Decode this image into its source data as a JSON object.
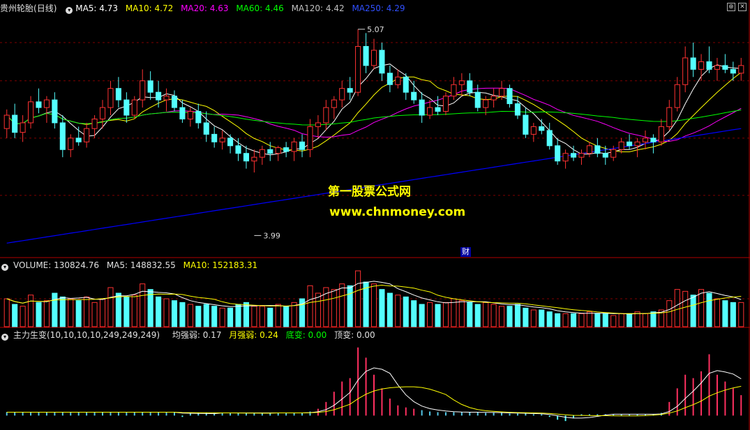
{
  "stock": {
    "name": "贵州轮胎",
    "period": "(日线)"
  },
  "price_header": {
    "ma5": "MA5: 4.73",
    "ma10": "MA10: 4.72",
    "ma20": "MA20: 4.63",
    "ma60": "MA60: 4.46",
    "ma120": "MA120: 4.42",
    "ma250": "MA250: 4.29"
  },
  "volume_header": {
    "label": "VOLUME: 130824.76",
    "ma5": "MA5: 148832.55",
    "ma10": "MA10: 152183.31"
  },
  "indicator_header": {
    "label": "主力生变(10,10,10,10,249,249,249)",
    "avg": "均强弱: 0.17",
    "month": "月强弱: 0.24",
    "bottom": "底变: 0.00",
    "top": "顶变: 0.00"
  },
  "annotations": {
    "high": "5.07",
    "low": "3.99",
    "finance_badge": "财"
  },
  "watermark": {
    "line1": "第一股票公式网",
    "line2": "www.chnmoney.com"
  },
  "colors": {
    "up": "#ff3232",
    "down": "#54ffff",
    "ma5": "#ffffff",
    "ma10": "#ffff00",
    "ma20": "#ff00ff",
    "ma60": "#00ff00",
    "ma120": "#c0c0c0",
    "ma250": "#0000ff"
  },
  "chart_data": {
    "type": "candlestick",
    "price_axis_range": [
      3.9,
      5.15
    ],
    "high_marker": 5.07,
    "low_marker": 3.99,
    "candles": [
      [
        4.55,
        4.65,
        4.5,
        4.62
      ],
      [
        4.62,
        4.68,
        4.5,
        4.53
      ],
      [
        4.53,
        4.62,
        4.48,
        4.58
      ],
      [
        4.58,
        4.72,
        4.55,
        4.69
      ],
      [
        4.69,
        4.76,
        4.63,
        4.66
      ],
      [
        4.66,
        4.72,
        4.58,
        4.7
      ],
      [
        4.7,
        4.74,
        4.55,
        4.58
      ],
      [
        4.58,
        4.62,
        4.4,
        4.44
      ],
      [
        4.44,
        4.52,
        4.4,
        4.5
      ],
      [
        4.5,
        4.56,
        4.46,
        4.48
      ],
      [
        4.48,
        4.58,
        4.45,
        4.55
      ],
      [
        4.55,
        4.62,
        4.5,
        4.6
      ],
      [
        4.6,
        4.7,
        4.55,
        4.66
      ],
      [
        4.66,
        4.8,
        4.62,
        4.76
      ],
      [
        4.76,
        4.82,
        4.66,
        4.7
      ],
      [
        4.7,
        4.74,
        4.58,
        4.62
      ],
      [
        4.62,
        4.72,
        4.6,
        4.7
      ],
      [
        4.7,
        4.86,
        4.66,
        4.8
      ],
      [
        4.8,
        4.85,
        4.7,
        4.74
      ],
      [
        4.74,
        4.8,
        4.66,
        4.7
      ],
      [
        4.7,
        4.76,
        4.64,
        4.72
      ],
      [
        4.72,
        4.75,
        4.64,
        4.66
      ],
      [
        4.66,
        4.7,
        4.58,
        4.6
      ],
      [
        4.6,
        4.66,
        4.56,
        4.64
      ],
      [
        4.64,
        4.68,
        4.55,
        4.58
      ],
      [
        4.58,
        4.64,
        4.48,
        4.52
      ],
      [
        4.52,
        4.56,
        4.45,
        4.48
      ],
      [
        4.48,
        4.54,
        4.44,
        4.5
      ],
      [
        4.5,
        4.52,
        4.42,
        4.46
      ],
      [
        4.46,
        4.5,
        4.38,
        4.42
      ],
      [
        4.42,
        4.46,
        4.34,
        4.38
      ],
      [
        4.38,
        4.44,
        4.32,
        4.4
      ],
      [
        4.4,
        4.46,
        4.36,
        4.44
      ],
      [
        4.44,
        4.48,
        4.38,
        4.42
      ],
      [
        4.42,
        4.46,
        4.38,
        4.45
      ],
      [
        4.45,
        4.48,
        4.4,
        4.43
      ],
      [
        4.43,
        4.5,
        4.38,
        4.48
      ],
      [
        4.48,
        4.52,
        4.4,
        4.44
      ],
      [
        4.44,
        4.6,
        4.4,
        4.56
      ],
      [
        4.56,
        4.62,
        4.5,
        4.58
      ],
      [
        4.58,
        4.7,
        4.54,
        4.66
      ],
      [
        4.66,
        4.72,
        4.6,
        4.7
      ],
      [
        4.7,
        4.8,
        4.66,
        4.76
      ],
      [
        4.76,
        4.82,
        4.7,
        4.74
      ],
      [
        4.74,
        5.07,
        4.72,
        4.98
      ],
      [
        4.98,
        5.05,
        4.84,
        4.88
      ],
      [
        4.88,
        5.02,
        4.86,
        4.96
      ],
      [
        4.96,
        5.0,
        4.8,
        4.84
      ],
      [
        4.84,
        4.88,
        4.74,
        4.78
      ],
      [
        4.78,
        4.86,
        4.76,
        4.82
      ],
      [
        4.82,
        4.84,
        4.7,
        4.74
      ],
      [
        4.74,
        4.8,
        4.68,
        4.7
      ],
      [
        4.7,
        4.74,
        4.58,
        4.62
      ],
      [
        4.62,
        4.7,
        4.6,
        4.66
      ],
      [
        4.66,
        4.72,
        4.62,
        4.64
      ],
      [
        4.64,
        4.74,
        4.62,
        4.72
      ],
      [
        4.72,
        4.82,
        4.7,
        4.78
      ],
      [
        4.78,
        4.84,
        4.72,
        4.8
      ],
      [
        4.8,
        4.84,
        4.72,
        4.74
      ],
      [
        4.74,
        4.78,
        4.64,
        4.66
      ],
      [
        4.66,
        4.72,
        4.62,
        4.7
      ],
      [
        4.7,
        4.76,
        4.66,
        4.72
      ],
      [
        4.72,
        4.8,
        4.7,
        4.76
      ],
      [
        4.76,
        4.78,
        4.66,
        4.68
      ],
      [
        4.68,
        4.72,
        4.6,
        4.62
      ],
      [
        4.62,
        4.66,
        4.5,
        4.52
      ],
      [
        4.52,
        4.58,
        4.48,
        4.56
      ],
      [
        4.56,
        4.6,
        4.52,
        4.54
      ],
      [
        4.54,
        4.58,
        4.44,
        4.46
      ],
      [
        4.46,
        4.5,
        4.36,
        4.38
      ],
      [
        4.38,
        4.44,
        4.34,
        4.42
      ],
      [
        4.42,
        4.46,
        4.38,
        4.4
      ],
      [
        4.4,
        4.44,
        4.36,
        4.42
      ],
      [
        4.42,
        4.48,
        4.4,
        4.46
      ],
      [
        4.46,
        4.5,
        4.4,
        4.42
      ],
      [
        4.42,
        4.46,
        4.36,
        4.4
      ],
      [
        4.4,
        4.46,
        4.38,
        4.44
      ],
      [
        4.44,
        4.5,
        4.42,
        4.48
      ],
      [
        4.48,
        4.52,
        4.44,
        4.46
      ],
      [
        4.46,
        4.5,
        4.4,
        4.48
      ],
      [
        4.48,
        4.54,
        4.44,
        4.5
      ],
      [
        4.5,
        4.52,
        4.42,
        4.48
      ],
      [
        4.48,
        4.6,
        4.46,
        4.56
      ],
      [
        4.56,
        4.7,
        4.54,
        4.66
      ],
      [
        4.66,
        4.82,
        4.64,
        4.78
      ],
      [
        4.78,
        4.98,
        4.74,
        4.92
      ],
      [
        4.92,
        5.0,
        4.82,
        4.86
      ],
      [
        4.86,
        4.94,
        4.8,
        4.9
      ],
      [
        4.9,
        4.98,
        4.84,
        4.86
      ],
      [
        4.86,
        4.92,
        4.8,
        4.88
      ],
      [
        4.88,
        4.94,
        4.84,
        4.86
      ],
      [
        4.86,
        4.9,
        4.8,
        4.84
      ],
      [
        4.84,
        4.92,
        4.8,
        4.88
      ]
    ],
    "volume_axis_max": 300000,
    "volume": [
      150000,
      120000,
      110000,
      170000,
      130000,
      140000,
      180000,
      160000,
      150000,
      140000,
      160000,
      130000,
      150000,
      210000,
      180000,
      160000,
      170000,
      230000,
      200000,
      160000,
      150000,
      140000,
      130000,
      120000,
      110000,
      120000,
      110000,
      100000,
      100000,
      120000,
      130000,
      110000,
      110000,
      100000,
      120000,
      110000,
      130000,
      150000,
      220000,
      180000,
      210000,
      200000,
      230000,
      220000,
      300000,
      240000,
      230000,
      200000,
      180000,
      170000,
      160000,
      140000,
      120000,
      130000,
      120000,
      130000,
      150000,
      140000,
      130000,
      120000,
      130000,
      120000,
      110000,
      110000,
      120000,
      100000,
      90000,
      90000,
      80000,
      70000,
      70000,
      70000,
      70000,
      80000,
      70000,
      70000,
      60000,
      70000,
      70000,
      80000,
      70000,
      80000,
      90000,
      140000,
      200000,
      190000,
      170000,
      200000,
      180000,
      150000,
      140000,
      130000,
      130000
    ],
    "indicator_axis_range": [
      -0.15,
      1.1
    ],
    "indicator": [
      0.05,
      0.05,
      0.05,
      0.05,
      0.05,
      0.05,
      0.05,
      0.05,
      0.05,
      0.05,
      0.05,
      0.05,
      0.05,
      0.05,
      0.05,
      0.05,
      0.05,
      0.05,
      0.05,
      0.05,
      0.05,
      0.05,
      -0.02,
      0.04,
      0.04,
      0.04,
      0.04,
      0.04,
      0.04,
      0.04,
      0.04,
      0.04,
      0.04,
      0.04,
      0.04,
      0.04,
      0.04,
      0.04,
      0.06,
      0.1,
      0.2,
      0.35,
      0.5,
      0.55,
      1.0,
      0.85,
      0.6,
      0.4,
      0.25,
      0.15,
      0.12,
      0.1,
      0.08,
      0.06,
      0.05,
      0.05,
      0.05,
      0.05,
      0.05,
      0.05,
      0.04,
      0.04,
      0.04,
      0.03,
      0.03,
      0.03,
      0.02,
      0.02,
      -0.02,
      -0.06,
      -0.08,
      -0.04,
      0.02,
      0.02,
      0.02,
      0.02,
      0.02,
      0.02,
      0.02,
      0.02,
      0.02,
      0.02,
      0.04,
      0.2,
      0.4,
      0.6,
      0.55,
      0.65,
      0.9,
      0.6,
      0.5,
      0.4,
      0.3
    ]
  }
}
